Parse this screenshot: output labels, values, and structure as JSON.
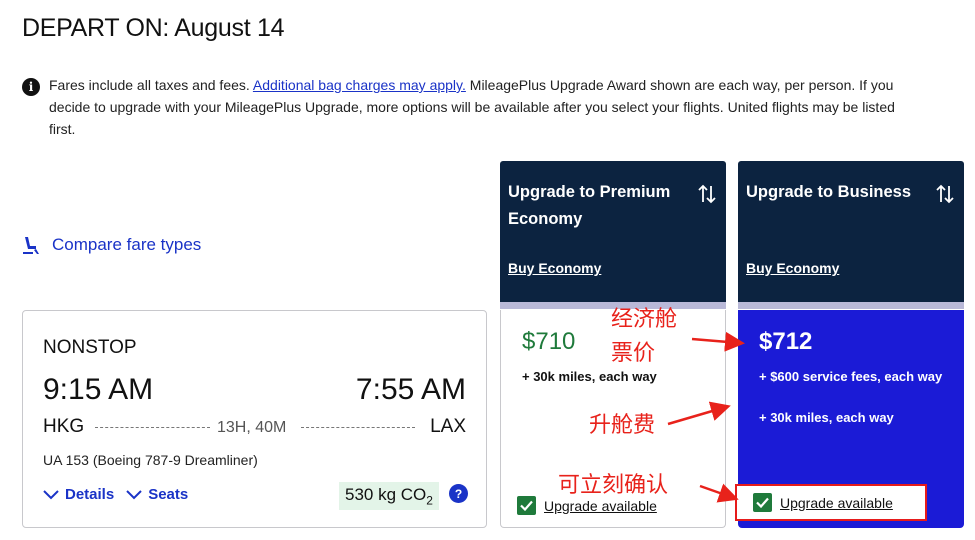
{
  "header": {
    "title": "DEPART ON: August 14"
  },
  "notice": {
    "icon": "info-icon",
    "text_before": "Fares include all taxes and fees. ",
    "link": "Additional bag charges may apply.",
    "text_after": " MileagePlus Upgrade Award shown are each way, per person. If you decide to upgrade with your MileagePlus Upgrade, more options will be available after you select your flights. United flights may be listed first."
  },
  "compare": {
    "label": "Compare fare types",
    "icon": "seat-icon"
  },
  "flight": {
    "stops": "NONSTOP",
    "depart_time": "9:15 AM",
    "arrive_time": "7:55 AM",
    "from": "HKG",
    "to": "LAX",
    "duration": "13H, 40M",
    "aircraft": "UA 153 (Boeing 787-9 Dreamliner)",
    "details_label": "Details",
    "seats_label": "Seats",
    "co2_value": "530 kg CO",
    "co2_sub": "2",
    "help": "?"
  },
  "columns": [
    {
      "title": "Upgrade to Premium Economy",
      "buy_label": "Buy Economy",
      "price": "$710",
      "line1": "+ 30k miles, each way",
      "line2": "",
      "upgrade_label": "Upgrade available"
    },
    {
      "title": "Upgrade to Business",
      "buy_label": "Buy Economy",
      "price": "$712",
      "line1": "+ $600 service fees, each way",
      "line2": "+ 30k miles, each way",
      "upgrade_label": "Upgrade available"
    }
  ],
  "annotations": {
    "economy_fare": "经济舱",
    "ticket_price": "票价",
    "upgrade_fee": "升舱费",
    "instant_confirm": "可立刻确认"
  },
  "colors": {
    "brand_blue": "#1a33c7",
    "navy": "#0c2340",
    "business_blue": "#1b1bd6",
    "green": "#1f7a3b",
    "annotation_red": "#e8221b"
  }
}
